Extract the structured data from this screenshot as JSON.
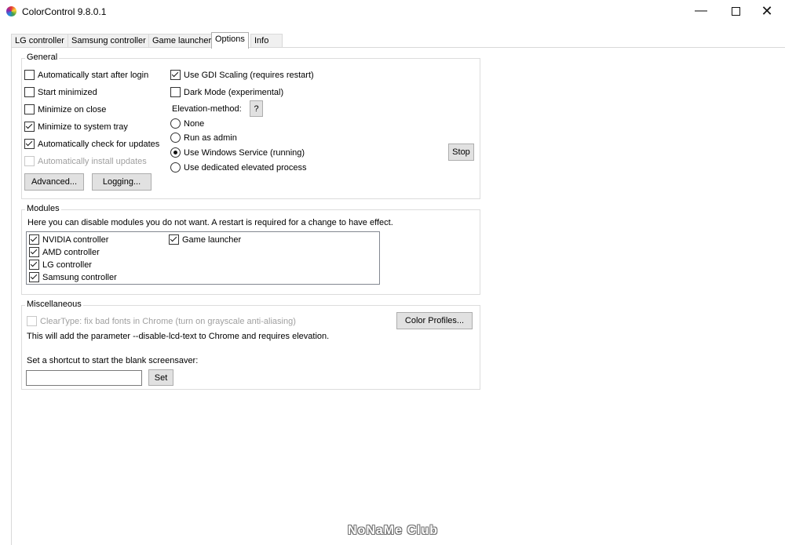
{
  "window": {
    "title": "ColorControl 9.8.0.1"
  },
  "titlebar": {
    "minimize": "—",
    "close": "✕"
  },
  "tabs": [
    {
      "label": "LG controller"
    },
    {
      "label": "Samsung controller"
    },
    {
      "label": "Game launcher"
    },
    {
      "label": "Options"
    },
    {
      "label": "Info"
    }
  ],
  "active_tab": "Options",
  "general": {
    "title": "General",
    "auto_start": {
      "label": "Automatically start after login",
      "checked": false
    },
    "start_minimized": {
      "label": "Start minimized",
      "checked": false
    },
    "minimize_on_close": {
      "label": "Minimize on close",
      "checked": false
    },
    "minimize_to_tray": {
      "label": "Minimize to system tray",
      "checked": true
    },
    "auto_check_updates": {
      "label": "Automatically check for updates",
      "checked": true
    },
    "auto_install_updates": {
      "label": "Automatically install updates",
      "checked": false,
      "disabled": true
    },
    "gdi_scaling": {
      "label": "Use GDI Scaling (requires restart)",
      "checked": true
    },
    "dark_mode": {
      "label": "Dark Mode (experimental)",
      "checked": false
    },
    "elevation_label": "Elevation-method:",
    "help_button": "?",
    "elevation_options": [
      {
        "label": "None",
        "selected": false
      },
      {
        "label": "Run as admin",
        "selected": false
      },
      {
        "label": "Use Windows Service (running)",
        "selected": true
      },
      {
        "label": "Use dedicated elevated process",
        "selected": false
      }
    ],
    "stop_button": "Stop",
    "advanced_button": "Advanced...",
    "logging_button": "Logging..."
  },
  "modules": {
    "title": "Modules",
    "description": "Here you can disable modules you do not want. A restart is required for a change to have effect.",
    "items": [
      {
        "label": "NVIDIA controller",
        "checked": true
      },
      {
        "label": "AMD controller",
        "checked": true
      },
      {
        "label": "LG controller",
        "checked": true
      },
      {
        "label": "Samsung controller",
        "checked": true
      },
      {
        "label": "Game launcher",
        "checked": true
      }
    ]
  },
  "misc": {
    "title": "Miscellaneous",
    "cleartype": {
      "label": "ClearType: fix bad fonts in Chrome (turn on grayscale anti-aliasing)",
      "checked": false,
      "disabled": true
    },
    "color_profiles_button": "Color Profiles...",
    "chrome_note": "This will add the parameter --disable-lcd-text to Chrome and requires elevation.",
    "shortcut_label": "Set a shortcut to start the blank screensaver:",
    "shortcut_value": "",
    "set_button": "Set"
  },
  "watermark": "NoNaMe Club"
}
